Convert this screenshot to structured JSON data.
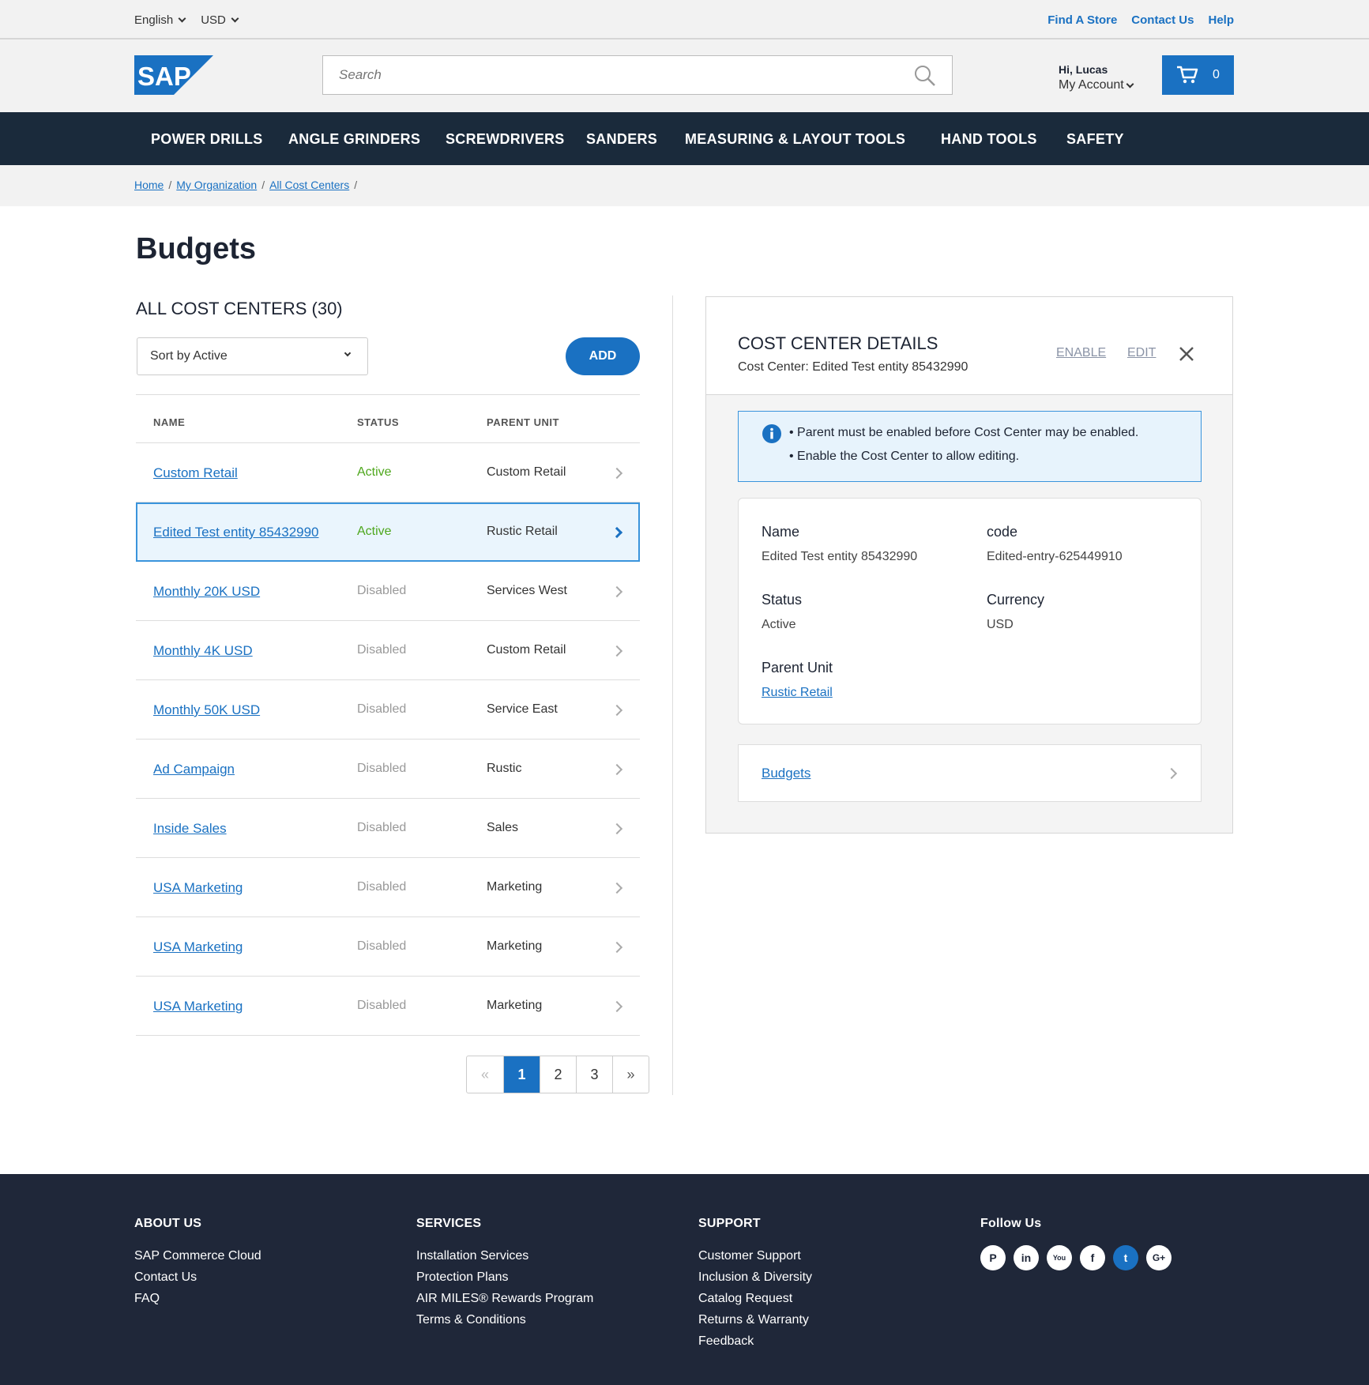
{
  "topbar": {
    "language": "English",
    "currency": "USD",
    "links": [
      "Find A Store",
      "Contact Us",
      "Help"
    ]
  },
  "header": {
    "logo_text": "SAP",
    "search_placeholder": "Search",
    "greeting": "Hi, Lucas",
    "account_label": "My Account",
    "cart_count": "0"
  },
  "nav": [
    "POWER DRILLS",
    "ANGLE GRINDERS",
    "SCREWDRIVERS",
    "SANDERS",
    "MEASURING & LAYOUT TOOLS",
    "HAND TOOLS",
    "SAFETY"
  ],
  "breadcrumb": [
    "Home",
    "My Organization",
    "All Cost Centers"
  ],
  "page_title": "Budgets",
  "list": {
    "title": "ALL COST CENTERS (30)",
    "sort_label": "Sort by Active",
    "add_label": "ADD",
    "columns": [
      "NAME",
      "STATUS",
      "PARENT UNIT"
    ],
    "rows": [
      {
        "name": "Custom Retail",
        "status": "Active",
        "parent": "Custom Retail"
      },
      {
        "name": "Edited Test entity 85432990",
        "status": "Active",
        "parent": "Rustic Retail"
      },
      {
        "name": "Monthly 20K USD",
        "status": "Disabled",
        "parent": "Services West"
      },
      {
        "name": "Monthly 4K USD",
        "status": "Disabled",
        "parent": "Custom Retail"
      },
      {
        "name": "Monthly 50K USD",
        "status": "Disabled",
        "parent": "Service East"
      },
      {
        "name": "Ad Campaign",
        "status": "Disabled",
        "parent": "Rustic"
      },
      {
        "name": "Inside Sales",
        "status": "Disabled",
        "parent": "Sales"
      },
      {
        "name": "USA Marketing",
        "status": "Disabled",
        "parent": "Marketing"
      },
      {
        "name": "USA Marketing",
        "status": "Disabled",
        "parent": "Marketing"
      },
      {
        "name": "USA Marketing",
        "status": "Disabled",
        "parent": "Marketing"
      }
    ],
    "pagination": {
      "prev": "«",
      "pages": [
        "1",
        "2",
        "3"
      ],
      "next": "»",
      "current": "1"
    }
  },
  "details": {
    "title": "COST CENTER DETAILS",
    "subtitle": "Cost Center: Edited Test entity 85432990",
    "enable_label": "ENABLE",
    "edit_label": "EDIT",
    "info": [
      "• Parent must be enabled before Cost Center may be enabled.",
      "• Enable the Cost Center to allow editing."
    ],
    "fields": {
      "name_label": "Name",
      "name_value": "Edited Test entity 85432990",
      "code_label": "code",
      "code_value": "Edited-entry-625449910",
      "status_label": "Status",
      "status_value": "Active",
      "currency_label": "Currency",
      "currency_value": "USD",
      "parent_label": "Parent Unit",
      "parent_value": "Rustic Retail"
    },
    "budgets_link": "Budgets"
  },
  "footer": {
    "about": {
      "title": "ABOUT US",
      "links": [
        "SAP Commerce Cloud",
        "Contact Us",
        "FAQ"
      ]
    },
    "services": {
      "title": "SERVICES",
      "links": [
        "Installation Services",
        "Protection Plans",
        "AIR MILES® Rewards Program",
        "Terms & Conditions"
      ]
    },
    "support": {
      "title": "SUPPORT",
      "links": [
        "Customer Support",
        "Inclusion & Diversity",
        "Catalog Request",
        "Returns & Warranty",
        "Feedback"
      ]
    },
    "follow": {
      "title": "Follow Us",
      "icons": [
        "pinterest-icon",
        "linkedin-icon",
        "youtube-icon",
        "facebook-icon",
        "twitter-icon",
        "google-plus-icon"
      ]
    }
  },
  "colors": {
    "brand_blue": "#1a71c2",
    "nav_dark": "#1a2a3b",
    "footer_dark": "#1f2739",
    "active_green": "#4ea71d"
  }
}
